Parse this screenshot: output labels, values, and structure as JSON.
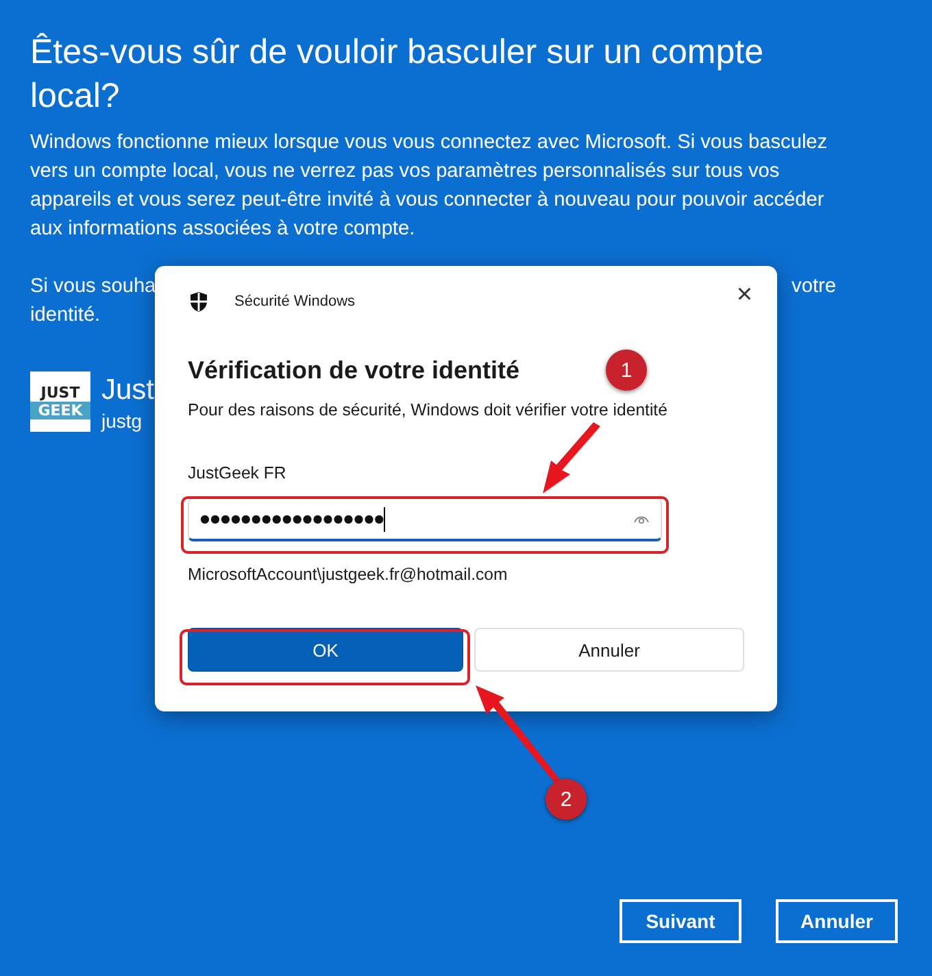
{
  "page": {
    "title": "Êtes-vous sûr de vouloir basculer sur un compte local?",
    "paragraph": "Windows fonctionne mieux lorsque vous vous connectez avec Microsoft. Si vous basculez vers un compte local, vous ne verrez pas vos paramètres personnalisés sur tous vos appareils et vous serez peut-être invité à vous connecter à nouveau pour pouvoir accéder aux informations associées à votre compte.",
    "paragraph_2_visible": [
      "Si vous souha",
      "votre",
      "identité."
    ],
    "account": {
      "logo_top": "JUST",
      "logo_bottom": "GEEK",
      "name": "Just",
      "email": "justg"
    },
    "buttons": [
      {
        "label": "Suivant"
      },
      {
        "label": "Annuler"
      }
    ]
  },
  "dialog": {
    "title": "Sécurité Windows",
    "close": "×",
    "heading": "Vérification de votre identité",
    "message": "Pour des raisons de sécurité, Windows doit vérifier votre identité",
    "user_label": "JustGeek FR",
    "password_field": {
      "value": "●●●●●●●●●●●●●●●●●●",
      "focused": true
    },
    "account_name": "MicrosoftAccount\\justgeek.fr@hotmail.com",
    "buttons": [
      {
        "label": "OK",
        "kind": "primary"
      },
      {
        "label": "Annuler",
        "kind": "secondary"
      }
    ]
  },
  "annotations": [
    {
      "label": "1"
    },
    {
      "label": "2"
    }
  ]
}
